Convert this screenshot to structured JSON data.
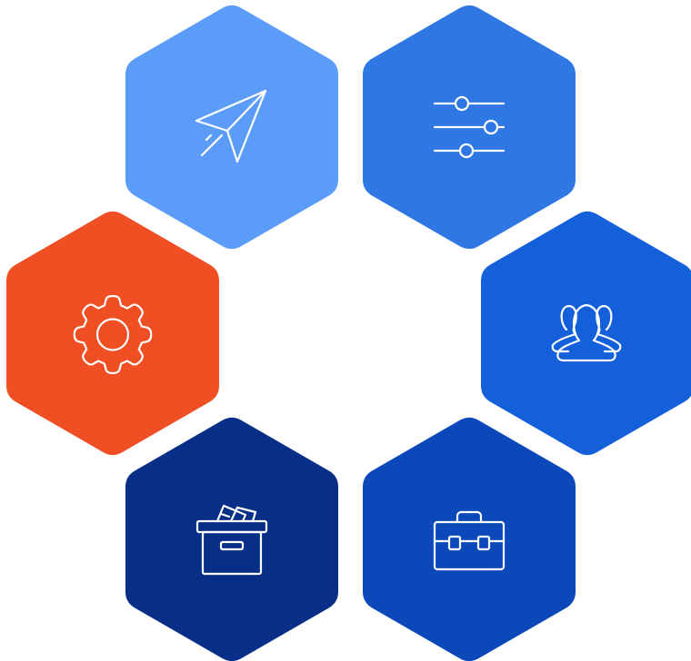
{
  "diagram": {
    "tiles": [
      {
        "id": "send",
        "icon": "paper-plane-icon",
        "color": "#5B9CF8"
      },
      {
        "id": "adjust",
        "icon": "sliders-icon",
        "color": "#2F78E3"
      },
      {
        "id": "team",
        "icon": "user-group-icon",
        "color": "#1360DA"
      },
      {
        "id": "work",
        "icon": "briefcase-icon",
        "color": "#0B49BB"
      },
      {
        "id": "archive",
        "icon": "archive-box-icon",
        "color": "#082F87"
      },
      {
        "id": "settings",
        "icon": "gear-icon",
        "color": "#F04E23"
      }
    ]
  }
}
